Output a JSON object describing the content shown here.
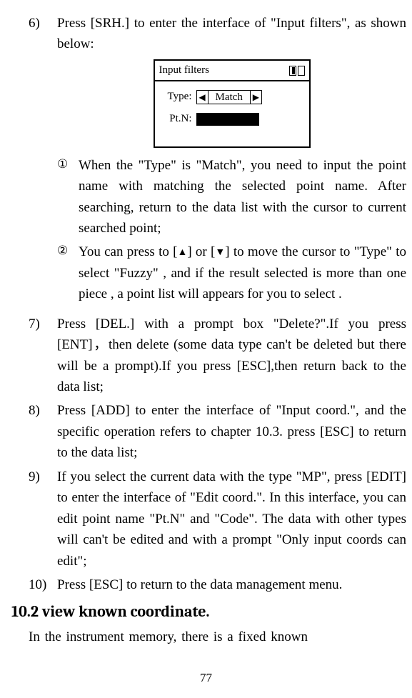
{
  "item6": {
    "num": "6)",
    "text": "Press [SRH.] to enter the interface of \"Input filters\", as shown below:"
  },
  "diagram": {
    "title": "Input filters",
    "type_label": "Type:",
    "type_value": "Match",
    "ptn_label": "Pt.N:"
  },
  "sub1": {
    "circ": "①",
    "text": "When the \"Type\" is \"Match\", you need to input the point name with matching the selected point name. After searching, return to the data list with the cursor to current searched point;"
  },
  "sub2": {
    "circ": "②",
    "text_a": "You can press to [",
    "text_b": "] or [",
    "text_c": "] to move the cursor to \"Type\" to select \"Fuzzy\" , and if the result selected is more than one piece , a point list will appears for you to select ."
  },
  "item7": {
    "num": "7)",
    "text": "Press [DEL.] with a prompt box \"Delete?\".If you press [ENT]，then delete (some data type can't be deleted but there will be a prompt).If you press [ESC],then return back to the data list;"
  },
  "item8": {
    "num": "8)",
    "text": "Press [ADD] to enter the interface of \"Input coord.\", and the specific operation refers to chapter 10.3. press [ESC] to return to the data list;"
  },
  "item9": {
    "num": "9)",
    "text": "If you select the current data with the type \"MP\", press [EDIT] to enter the interface of \"Edit coord.\". In this interface, you can edit point name \"Pt.N\" and \"Code\". The data with other types will can't be edited and with a prompt \"Only input coords can edit\";"
  },
  "item10": {
    "num": "10)",
    "text": "Press [ESC] to return to the data management menu."
  },
  "section_heading": "10.2 view known coordinate.",
  "section_para": "In  the  instrument  memory,  there  is  a  fixed  known",
  "page_number": "77",
  "glyphs": {
    "up": "▲",
    "down": "▼",
    "left": "◀",
    "right": "▶"
  }
}
